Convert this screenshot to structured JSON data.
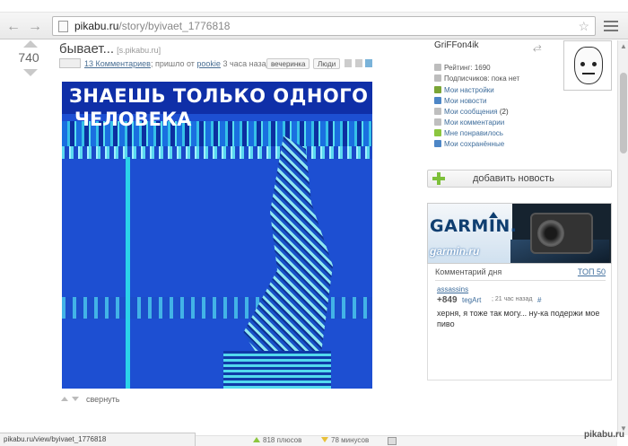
{
  "browser": {
    "url_host": "pikabu.ru",
    "url_path": "/story/byivaet_1776818"
  },
  "story": {
    "rating": "740",
    "title": "бывает...",
    "source": "[s.pikabu.ru]",
    "comments": "13 Комментариев",
    "meta_prefix": "; пришло от",
    "author": "pookie",
    "meta_time": "3 часа назад",
    "tags": [
      "вечеринка",
      "Люди"
    ],
    "image_caption_line1": "ЗНАЕШЬ ТОЛЬКО ОДНОГО",
    "image_caption_line2": "ЧЕЛОВЕКА",
    "collapse_label": "свернуть"
  },
  "user_panel": {
    "username": "GriFFon4ik",
    "rating": "Рейтинг: 1690",
    "subscribers": "Подписчиков: пока нет",
    "links": [
      {
        "label": "Мои настройки",
        "color": "#7aa536"
      },
      {
        "label": "Мои новости",
        "color": "#4d86c6"
      },
      {
        "label": "Мои сообщения",
        "count": "(2)",
        "color": "#bfbfbf"
      },
      {
        "label": "Мои комментарии",
        "color": "#bfbfbf"
      },
      {
        "label": "Мне понравилось",
        "color": "#8cc63f"
      },
      {
        "label": "Мои сохранённые",
        "color": "#4d86c6"
      }
    ]
  },
  "add_news": {
    "label": "добавить новость"
  },
  "ad": {
    "brand": "GARMIN.",
    "site": "garmin.ru"
  },
  "comment_of_day": {
    "title": "Комментарий дня",
    "top_link": "ТОП 50",
    "user": "assassins",
    "score": "+849",
    "author": "tegArt",
    "time": "; 21 час назад",
    "hash": "#",
    "text": "херня, я тоже так могу... ну-ка подержи мое пиво"
  },
  "statusbar": {
    "url": "pikabu.ru/view/byivaet_1776818"
  },
  "bottom_bar": {
    "pluses": "818 плюсов",
    "minuses": "78 минусов"
  },
  "watermark": "pikabu.ru"
}
